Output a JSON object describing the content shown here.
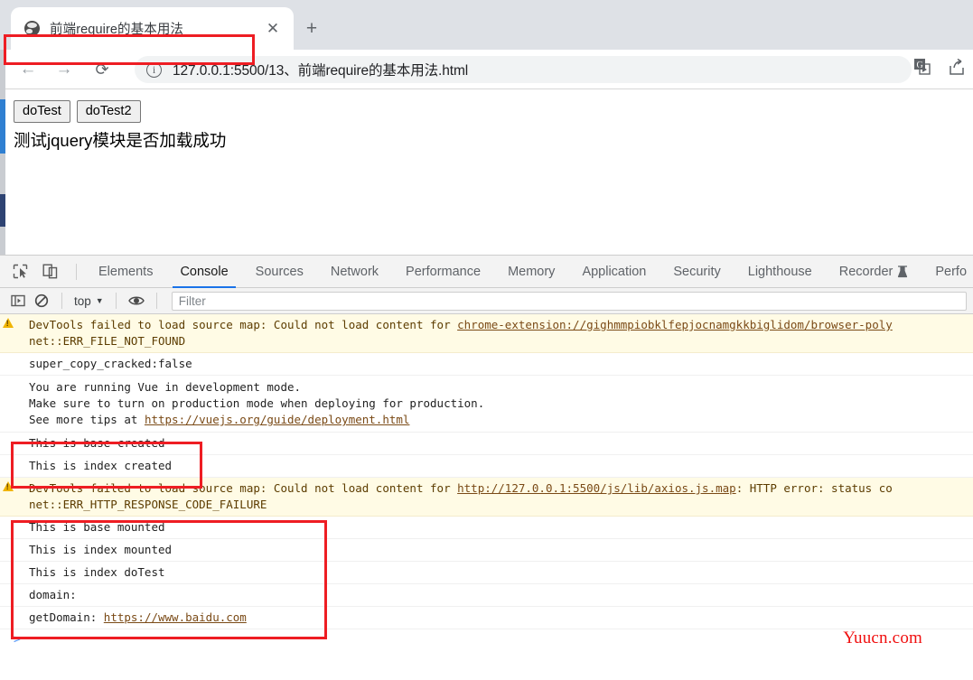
{
  "browser": {
    "tab": {
      "title": "前端require的基本用法",
      "favicon": "globe-icon",
      "close": "✕"
    },
    "new_tab_label": "+",
    "nav": {
      "back": "←",
      "forward": "→",
      "reload": "⟳"
    },
    "omnibox": {
      "url": "127.0.0.1:5500/13、前端require的基本用法.html",
      "info_icon": "ⓘ"
    },
    "right_icons": [
      "translate-icon",
      "share-icon"
    ]
  },
  "page": {
    "buttons": [
      {
        "label": "doTest"
      },
      {
        "label": "doTest2"
      }
    ],
    "jquery_text": "测试jquery模块是否加载成功"
  },
  "devtools": {
    "tool_icons": [
      "inspect-element-icon",
      "device-toolbar-icon"
    ],
    "tabs": [
      {
        "label": "Elements",
        "active": false
      },
      {
        "label": "Console",
        "active": true
      },
      {
        "label": "Sources",
        "active": false
      },
      {
        "label": "Network",
        "active": false
      },
      {
        "label": "Performance",
        "active": false
      },
      {
        "label": "Memory",
        "active": false
      },
      {
        "label": "Application",
        "active": false
      },
      {
        "label": "Security",
        "active": false
      },
      {
        "label": "Lighthouse",
        "active": false
      },
      {
        "label": "Recorder",
        "active": false,
        "badge": "flask-icon"
      },
      {
        "label": "Perfo",
        "active": false
      }
    ],
    "filterbar": {
      "sidebar_icon": "console-sidebar-icon",
      "clear_icon": "clear-console-icon",
      "context": "top",
      "context_caret": "▼",
      "eye_icon": "live-expression-icon",
      "filter_placeholder": "Filter"
    },
    "console_rows": [
      {
        "type": "warning",
        "line1_pre": "DevTools failed to load source map: Could not load content for ",
        "line1_link": "chrome-extension://gighmmpiobklfepjocnamgkkbiglidom/browser-poly",
        "line2": "net::ERR_FILE_NOT_FOUND"
      },
      {
        "type": "log",
        "text": "super_copy_cracked:false"
      },
      {
        "type": "log-multiline",
        "lines": [
          "You are running Vue in development mode.",
          "Make sure to turn on production mode when deploying for production.",
          "See more tips at "
        ],
        "link": "https://vuejs.org/guide/deployment.html"
      },
      {
        "type": "log",
        "text": "This is base created"
      },
      {
        "type": "log",
        "text": "This is index created"
      },
      {
        "type": "warning",
        "line1_pre": "DevTools failed to load source map: Could not load content for ",
        "line1_link": "http://127.0.0.1:5500/js/lib/axios.js.map",
        "line1_post": ": HTTP error: status co",
        "line2": "net::ERR_HTTP_RESPONSE_CODE_FAILURE"
      },
      {
        "type": "log",
        "text": "This is base mounted"
      },
      {
        "type": "log",
        "text": "This is index mounted"
      },
      {
        "type": "log",
        "text": "This is index doTest"
      },
      {
        "type": "log",
        "text": "domain:"
      },
      {
        "type": "log-link",
        "text": "getDomain: ",
        "link": "https://www.baidu.com"
      }
    ],
    "prompt": ">"
  },
  "watermark": "Yuucn.com",
  "colors": {
    "accent": "#1a73e8",
    "highlight_box": "#ee1d23",
    "warning_bg": "#fffbe5",
    "watermark": "#f01010"
  }
}
